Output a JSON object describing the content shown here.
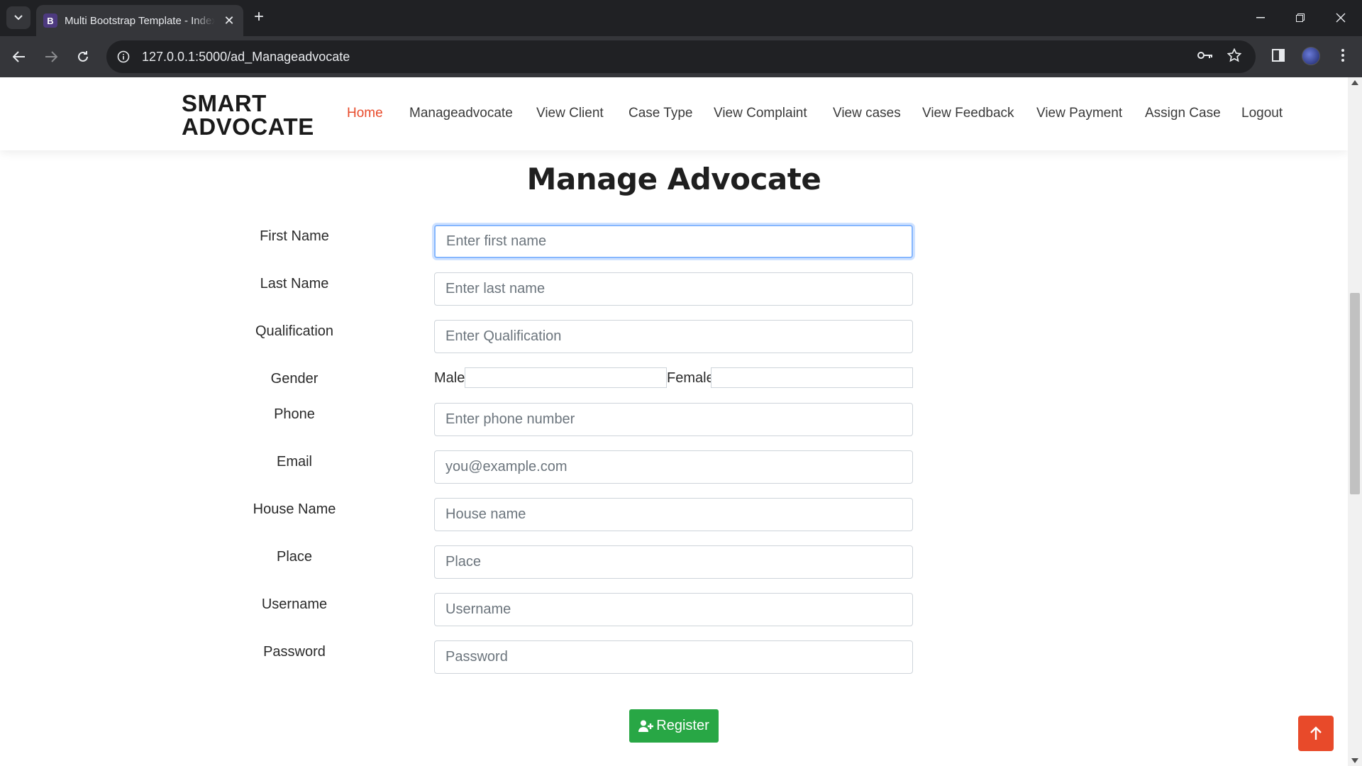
{
  "browser": {
    "tab_title": "Multi Bootstrap Template - Index",
    "tab_favicon_letter": "B",
    "url": "127.0.0.1:5000/ad_Manageadvocate"
  },
  "site": {
    "logo_line1": "SMART",
    "logo_line2": "ADVOCATE",
    "nav": [
      "Home",
      "Manageadvocate",
      "View Client",
      "Case Type",
      "View Complaint",
      "View cases",
      "View Feedback",
      "View Payment",
      "Assign Case",
      "Logout"
    ],
    "active_nav": "Home",
    "accent_color": "#e84a2a"
  },
  "form": {
    "title": "Manage Advocate",
    "fields": [
      {
        "label": "First Name",
        "placeholder": "Enter first name",
        "value": ""
      },
      {
        "label": "Last Name",
        "placeholder": "Enter last name",
        "value": ""
      },
      {
        "label": "Qualification",
        "placeholder": "Enter Qualification",
        "value": ""
      },
      {
        "label": "Phone",
        "placeholder": "Enter phone number",
        "value": ""
      },
      {
        "label": "Email",
        "placeholder": "you@example.com",
        "value": ""
      },
      {
        "label": "House Name",
        "placeholder": "House name",
        "value": ""
      },
      {
        "label": "Place",
        "placeholder": "Place",
        "value": ""
      },
      {
        "label": "Username",
        "placeholder": "Username",
        "value": ""
      },
      {
        "label": "Password",
        "placeholder": "Password",
        "value": ""
      }
    ],
    "gender": {
      "label": "Gender",
      "options": [
        "Male",
        "Female"
      ]
    },
    "submit_label": "Register",
    "submit_color": "#28a745"
  }
}
